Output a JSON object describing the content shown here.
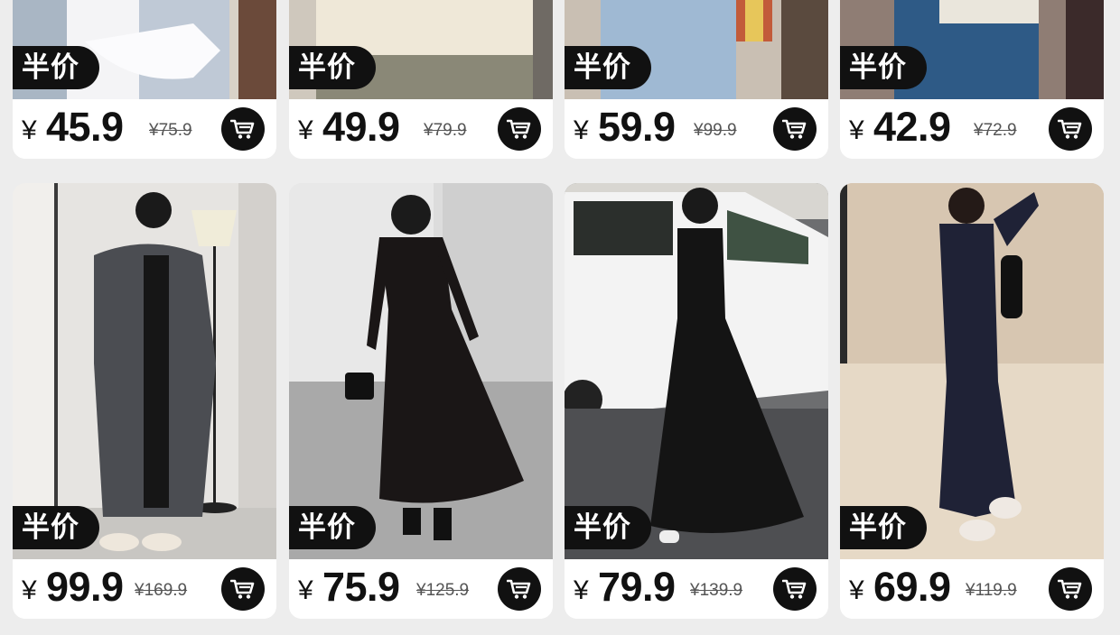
{
  "products": [
    {
      "badge": "半价",
      "currency": "¥",
      "price": "45.9",
      "original": "¥75.9",
      "cart_icon": "cart-icon",
      "image": "light-knit-sweater-photo"
    },
    {
      "badge": "半价",
      "currency": "¥",
      "price": "49.9",
      "original": "¥79.9",
      "cart_icon": "cart-icon",
      "image": "cream-knit-top-photo"
    },
    {
      "badge": "半价",
      "currency": "¥",
      "price": "59.9",
      "original": "¥99.9",
      "cart_icon": "cart-icon",
      "image": "denim-jeans-photo"
    },
    {
      "badge": "半价",
      "currency": "¥",
      "price": "42.9",
      "original": "¥72.9",
      "cart_icon": "cart-icon",
      "image": "denim-jeans-photo"
    },
    {
      "badge": "半价",
      "currency": "¥",
      "price": "99.9",
      "original": "¥169.9",
      "cart_icon": "cart-icon",
      "image": "long-grey-cardigan-photo"
    },
    {
      "badge": "半价",
      "currency": "¥",
      "price": "75.9",
      "original": "¥125.9",
      "cart_icon": "cart-icon",
      "image": "black-long-dress-photo"
    },
    {
      "badge": "半价",
      "currency": "¥",
      "price": "79.9",
      "original": "¥139.9",
      "cart_icon": "cart-icon",
      "image": "black-dress-by-car-photo"
    },
    {
      "badge": "半价",
      "currency": "¥",
      "price": "69.9",
      "original": "¥119.9",
      "cart_icon": "cart-icon",
      "image": "navy-bodycon-dress-photo"
    }
  ],
  "colors": {
    "page_bg": "#ededed",
    "card_bg": "#ffffff",
    "badge_bg": "#111111",
    "text": "#111111",
    "cart_bg": "#111111"
  }
}
